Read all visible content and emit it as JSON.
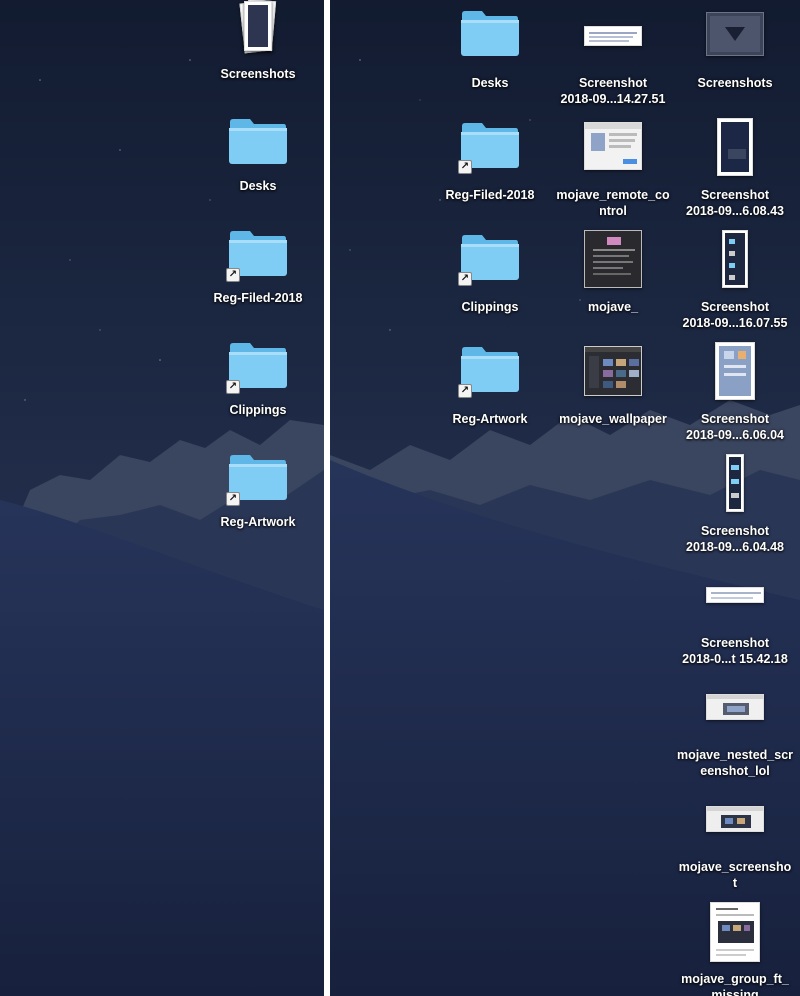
{
  "colors": {
    "sky_top": "#121b30",
    "sky_bottom": "#2c3b5c",
    "mountain_far": "#39445e",
    "mountain_near": "#243152",
    "dune": "#1c2746",
    "folder_blue": "#7fcdf5",
    "folder_tab": "#5fb7e8",
    "divider": "#ffffff",
    "label_text": "#ffffff"
  },
  "left_pane": {
    "items": [
      {
        "name": "Screenshots",
        "kind": "stack-icon"
      },
      {
        "name": "Desks",
        "kind": "folder-icon"
      },
      {
        "name": "Reg-Filed-2018",
        "kind": "alias-folder-icon"
      },
      {
        "name": "Clippings",
        "kind": "alias-folder-icon"
      },
      {
        "name": "Reg-Artwork",
        "kind": "alias-folder-icon"
      }
    ]
  },
  "right_pane": {
    "items": [
      {
        "name": "Desks",
        "kind": "folder-icon"
      },
      {
        "name": "Screenshot\n2018-09...14.27.51",
        "kind": "thumbnail-icon"
      },
      {
        "name": "Screenshots",
        "kind": "stack-icon"
      },
      {
        "name": "Reg-Filed-2018",
        "kind": "alias-folder-icon"
      },
      {
        "name": "mojave_remote_co\nntrol",
        "kind": "thumbnail-icon"
      },
      {
        "name": "Screenshot\n2018-09...6.08.43",
        "kind": "thumbnail-icon"
      },
      {
        "name": "Clippings",
        "kind": "alias-folder-icon"
      },
      {
        "name": "mojave_",
        "kind": "thumbnail-icon"
      },
      {
        "name": "Screenshot\n2018-09...16.07.55",
        "kind": "thumbnail-icon"
      },
      {
        "name": "Reg-Artwork",
        "kind": "alias-folder-icon"
      },
      {
        "name": "mojave_wallpaper",
        "kind": "thumbnail-icon"
      },
      {
        "name": "Screenshot\n2018-09...6.06.04",
        "kind": "thumbnail-icon"
      },
      {
        "name": "Screenshot\n2018-09...6.04.48",
        "kind": "thumbnail-icon"
      },
      {
        "name": "Screenshot\n2018-0...t 15.42.18",
        "kind": "thumbnail-icon"
      },
      {
        "name": "mojave_nested_scr\neenshot_lol",
        "kind": "thumbnail-icon"
      },
      {
        "name": "mojave_screensho\nt",
        "kind": "thumbnail-icon"
      },
      {
        "name": "mojave_group_ft_\nmissing",
        "kind": "thumbnail-icon"
      }
    ]
  }
}
